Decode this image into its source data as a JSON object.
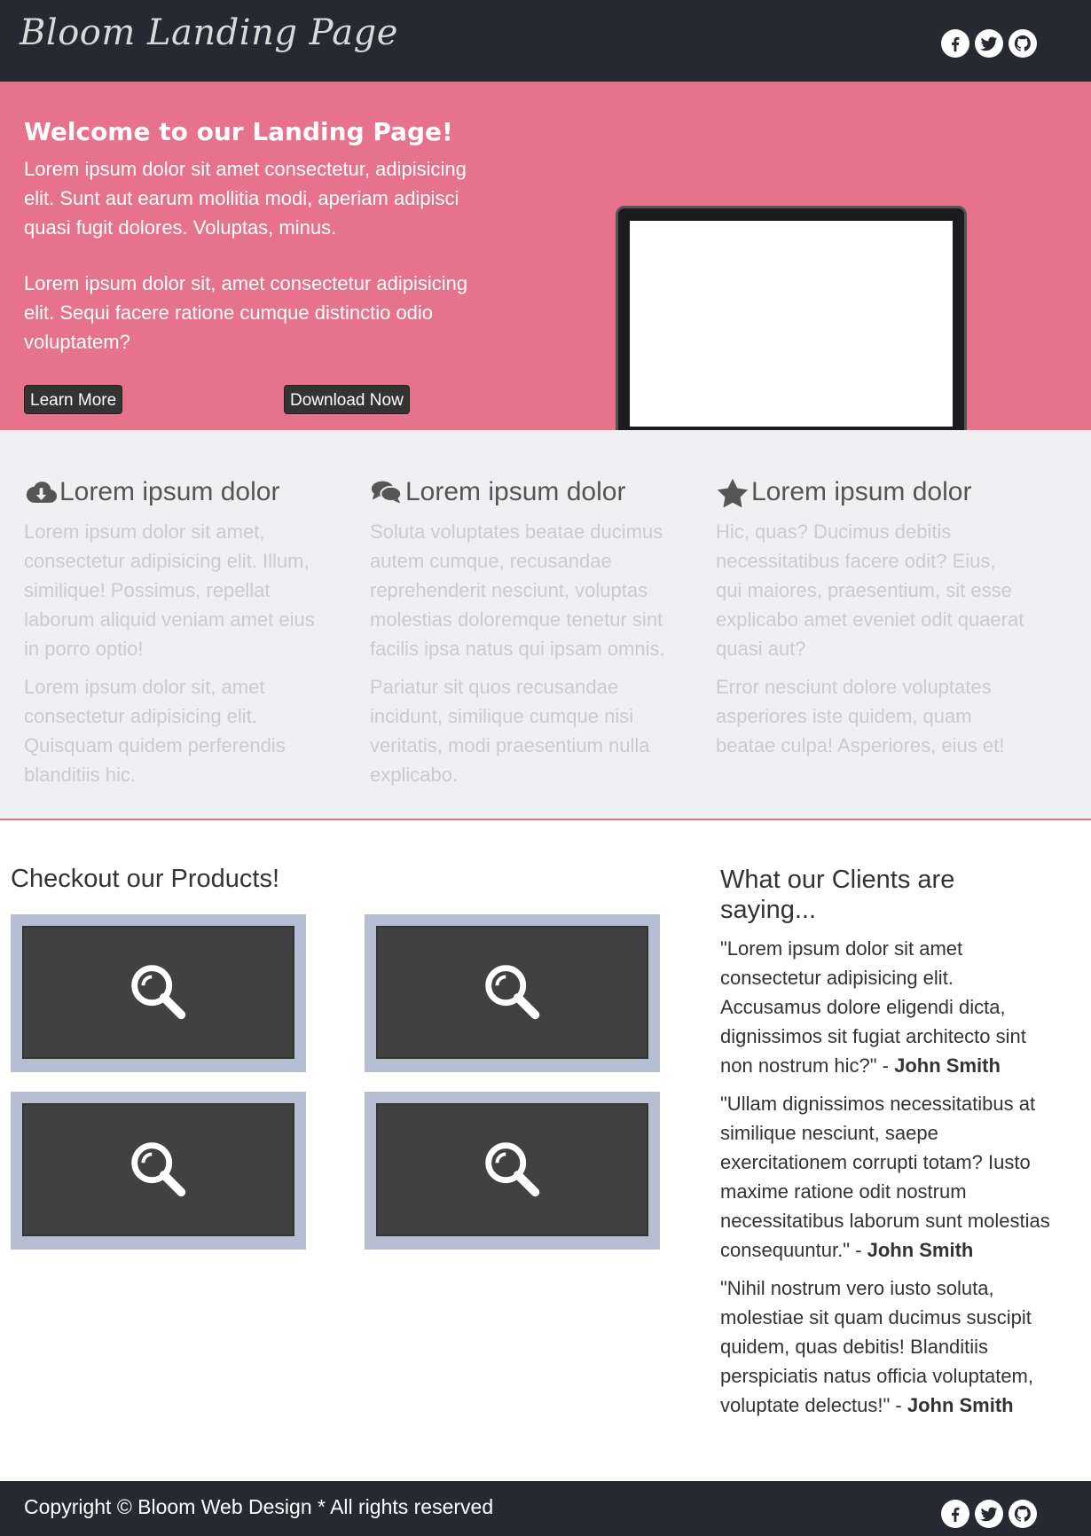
{
  "header": {
    "brand": "Bloom Landing Page",
    "social_icons": [
      "facebook-icon",
      "twitter-icon",
      "github-icon"
    ]
  },
  "hero": {
    "title": "Welcome to our Landing Page!",
    "paragraph1": "Lorem ipsum dolor sit amet consectetur, adipisicing elit. Sunt aut earum mollitia modi, aperiam adipisci quasi fugit dolores. Voluptas, minus.",
    "paragraph2": "Lorem ipsum dolor sit, amet consectetur adipisicing elit. Sequi facere ratione cumque distinctio odio voluptatem?",
    "learn_more": "Learn More",
    "download_now": "Download Now",
    "image_icon": "laptop-image"
  },
  "features": [
    {
      "icon": "cloud-download-icon",
      "title": "Lorem ipsum dolor",
      "p1": "Lorem ipsum dolor sit amet, consectetur adipisicing elit. Illum, similique! Possimus, repellat laborum aliquid veniam amet eius in porro optio!",
      "p2": "Lorem ipsum dolor sit, amet consectetur adipisicing elit. Quisquam quidem perferendis blanditiis hic."
    },
    {
      "icon": "comments-icon",
      "title": "Lorem ipsum dolor",
      "p1": "Soluta voluptates beatae ducimus autem cumque, recusandae reprehenderit nesciunt, voluptas molestias doloremque tenetur sint facilis ipsa natus qui ipsam omnis.",
      "p2": "Pariatur sit quos recusandae incidunt, similique cumque nisi veritatis, modi praesentium nulla explicabo."
    },
    {
      "icon": "star-icon",
      "title": "Lorem ipsum dolor",
      "p1": "Hic, quas? Ducimus debitis necessitatibus facere odit? Eius, qui maiores, praesentium, sit esse explicabo amet eveniet odit quaerat quasi aut?",
      "p2": "Error nesciunt dolore voluptates asperiores iste quidem, quam beatae culpa! Asperiores, eius et!"
    }
  ],
  "products": {
    "title": "Checkout our Products!",
    "thumbnail_icon": "magnifier-icon"
  },
  "clients": {
    "title": "What our Clients are saying...",
    "quotes": [
      {
        "text": "\"Lorem ipsum dolor sit amet consectetur adipisicing elit. Accusamus dolore eligendi dicta, dignissimos sit fugiat architecto sint non nostrum hic?\" - ",
        "author": "John Smith"
      },
      {
        "text": "\"Ullam dignissimos necessitatibus at similique nesciunt, saepe exercitationem corrupti totam? Iusto maxime ratione odit nostrum necessitatibus laborum sunt molestias consequuntur.\" - ",
        "author": "John Smith"
      },
      {
        "text": "\"Nihil nostrum vero iusto soluta, molestiae sit quam ducimus suscipit quidem, quas debitis! Blanditiis perspiciatis natus officia voluptatem, voluptate delectus!\" - ",
        "author": "John Smith"
      }
    ]
  },
  "footer": {
    "copyright": "Copyright © Bloom Web Design * All rights reserved"
  },
  "colors": {
    "header_bg": "#262a30",
    "hero_bg": "#e7728c",
    "features_bg": "#f0f0f2",
    "muted_text": "#c9cbd0",
    "thumb_frame": "#b8bed2"
  }
}
